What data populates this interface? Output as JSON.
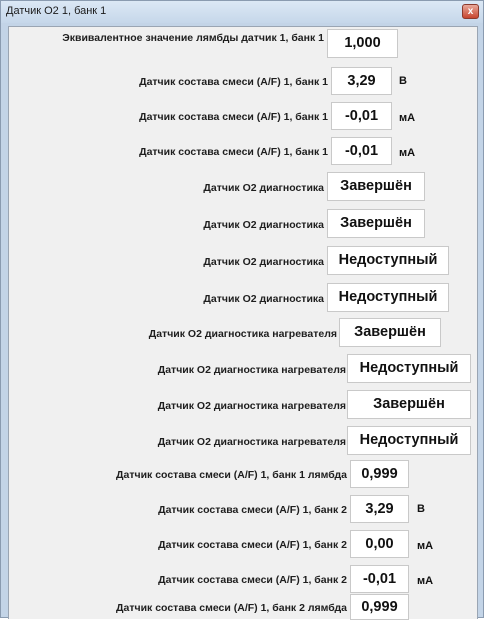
{
  "window": {
    "title": "Датчик О2 1, банк 1",
    "close_glyph": "x"
  },
  "rows": [
    {
      "label": "Эквивалентное значение лямбды датчик 1, банк 1",
      "value": "1,000",
      "unit": ""
    },
    {
      "label": "Датчик состава смеси (A/F) 1, банк 1",
      "value": "3,29",
      "unit": "В"
    },
    {
      "label": "Датчик состава смеси (A/F) 1, банк 1",
      "value": "-0,01",
      "unit": "мА"
    },
    {
      "label": "Датчик состава смеси (A/F) 1, банк 1",
      "value": "-0,01",
      "unit": "мА"
    },
    {
      "label": "Датчик О2 диагностика",
      "value": "Завершён",
      "unit": ""
    },
    {
      "label": "Датчик О2 диагностика",
      "value": "Завершён",
      "unit": ""
    },
    {
      "label": "Датчик О2 диагностика",
      "value": "Недоступный",
      "unit": ""
    },
    {
      "label": "Датчик О2 диагностика",
      "value": "Недоступный",
      "unit": ""
    },
    {
      "label": "Датчик О2 диагностика нагревателя",
      "value": "Завершён",
      "unit": ""
    },
    {
      "label": "Датчик О2 диагностика нагревателя",
      "value": "Недоступный",
      "unit": ""
    },
    {
      "label": "Датчик О2 диагностика нагревателя",
      "value": "Завершён",
      "unit": ""
    },
    {
      "label": "Датчик О2 диагностика нагревателя",
      "value": "Недоступный",
      "unit": ""
    },
    {
      "label": "Датчик состава смеси (A/F) 1, банк 1 лямбда",
      "value": "0,999",
      "unit": ""
    },
    {
      "label": "Датчик состава смеси (A/F) 1, банк 2",
      "value": "3,29",
      "unit": "В"
    },
    {
      "label": "Датчик состава смеси (A/F) 1, банк 2",
      "value": "0,00",
      "unit": "мА"
    },
    {
      "label": "Датчик состава смеси (A/F) 1, банк 2",
      "value": "-0,01",
      "unit": "мА"
    },
    {
      "label": "Датчик состава смеси (A/F) 1, банк 2 лямбда",
      "value": "0,999",
      "unit": ""
    }
  ],
  "colors": {
    "titlebar": "#c6d7ea",
    "panel": "#f0f0f0",
    "value_box": "#ffffff",
    "close_button": "#c7452f"
  }
}
